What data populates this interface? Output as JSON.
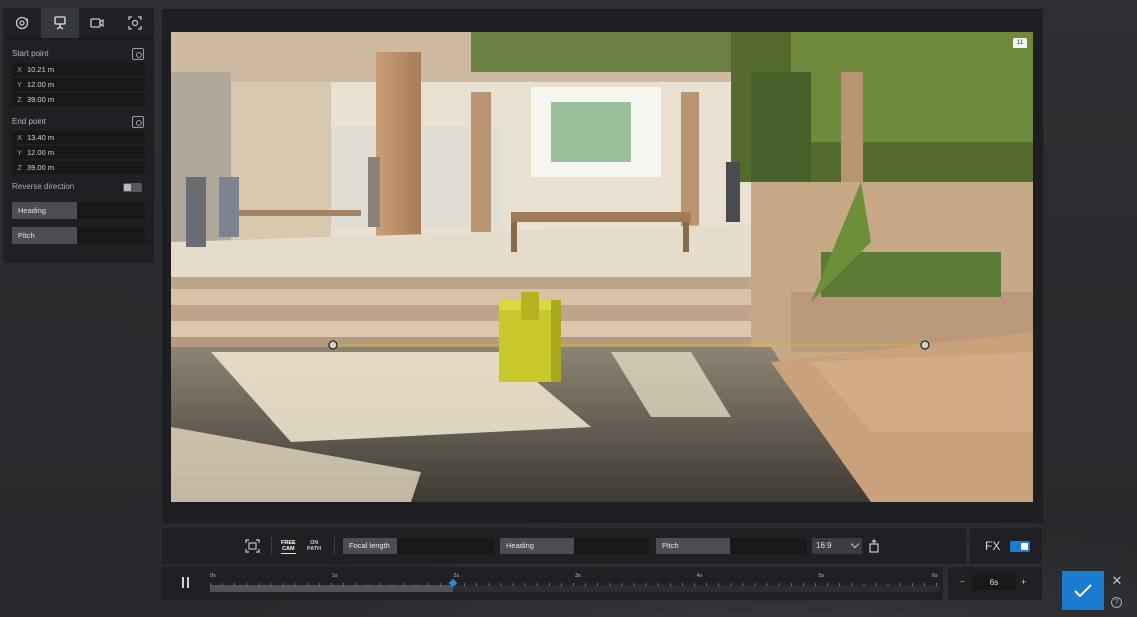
{
  "left_panel": {
    "tabs": [
      {
        "icon": "orbit-icon"
      },
      {
        "icon": "camera-tripod-icon"
      },
      {
        "icon": "video-camera-icon"
      },
      {
        "icon": "focus-frame-icon"
      }
    ],
    "start_point": {
      "title": "Start point",
      "x_axis": "X",
      "x": "10.21 m",
      "y_axis": "Y",
      "y": "12.00 m",
      "z_axis": "Z",
      "z": "39.00 m"
    },
    "end_point": {
      "title": "End point",
      "x_axis": "X",
      "x": "13.40 m",
      "y_axis": "Y",
      "y": "12.00 m",
      "z_axis": "Z",
      "z": "39.00 m"
    },
    "reverse_direction": {
      "label": "Reverse direction",
      "on": false
    },
    "heading": {
      "label": "Heading",
      "fill": 0.49
    },
    "pitch": {
      "label": "Pitch",
      "fill": 0.49
    }
  },
  "viewport": {
    "badge": "11"
  },
  "camera_bar": {
    "free_cam_line1": "FREE",
    "free_cam_line2": "CAM",
    "on_path_line1": "ON",
    "on_path_line2": "PATH",
    "focal_length": {
      "label": "Focal length",
      "fill": 0.36
    },
    "heading": {
      "label": "Heading",
      "fill": 0.49
    },
    "pitch": {
      "label": "Pitch",
      "fill": 0.49
    },
    "aspect_ratio": "16:9"
  },
  "fx": {
    "label": "FX",
    "on": true
  },
  "timeline": {
    "tick_labels": [
      "0s",
      "1s",
      "2s",
      "3s",
      "4s",
      "5s",
      "6s"
    ],
    "progress": 0.333
  },
  "duration": {
    "value": "6s",
    "minus": "−",
    "plus": "+"
  },
  "actions": {
    "close": "✕",
    "help": "?"
  },
  "colors": {
    "accent": "#1a7ccf",
    "panel": "#1e2023",
    "path_line": "#c2c427",
    "object": "#c8c82a"
  }
}
